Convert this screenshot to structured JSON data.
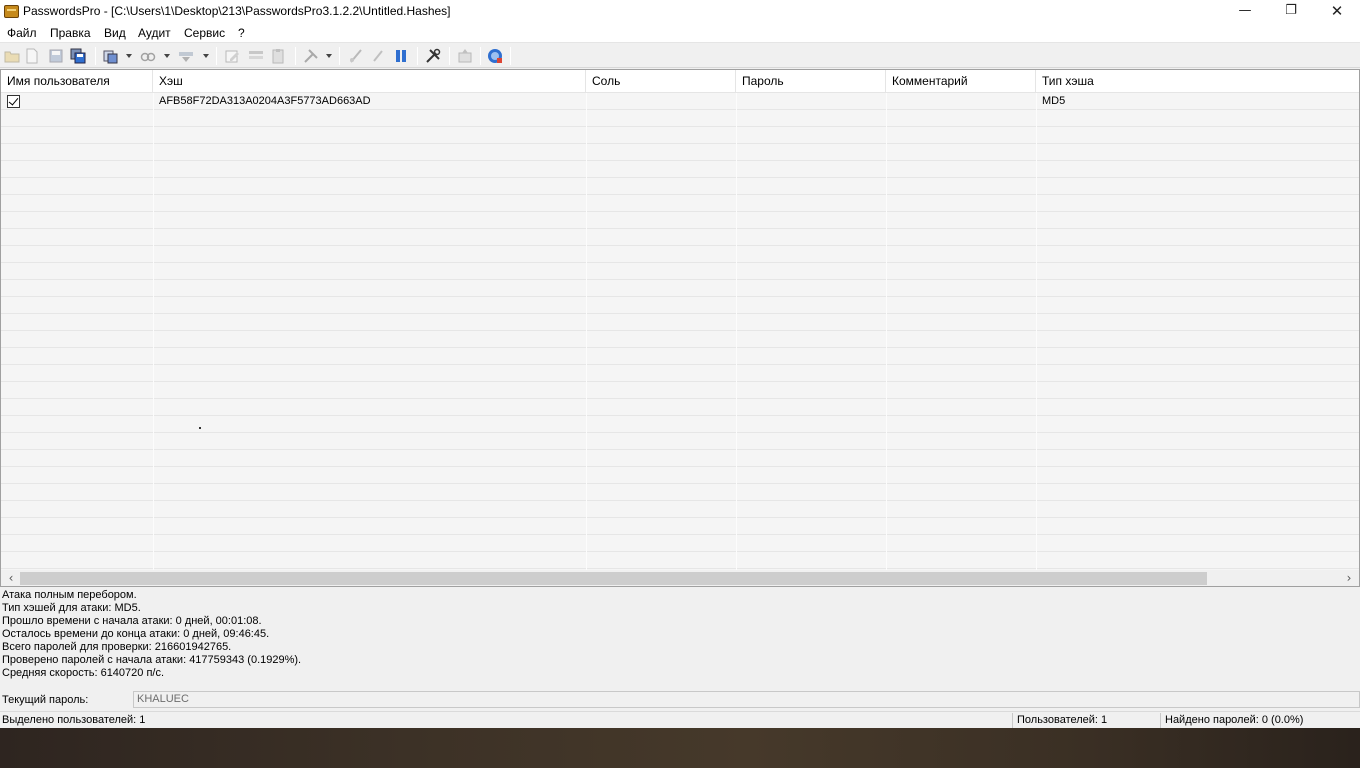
{
  "window": {
    "title": "PasswordsPro - [C:\\Users\\1\\Desktop\\213\\PasswordsPro3.1.2.2\\Untitled.Hashes]",
    "minimize_glyph": "—",
    "maximize_glyph": "❐",
    "close_glyph": "✕"
  },
  "menu": [
    "Файл",
    "Правка",
    "Вид",
    "Аудит",
    "Сервис",
    "?"
  ],
  "grid": {
    "columns": [
      "Имя пользователя",
      "Хэш",
      "Соль",
      "Пароль",
      "Комментарий",
      "Тип хэша"
    ],
    "rows": [
      {
        "checked": true,
        "user": "",
        "hash": "AFB58F72DA313A0204A3F5773AD663AD",
        "salt": "",
        "password": "",
        "comment": "",
        "hash_type": "MD5"
      }
    ]
  },
  "scrollbar": {
    "left_glyph": "‹",
    "right_glyph": "›"
  },
  "log": [
    "Атака полным перебором.",
    "Тип хэшей для атаки: MD5.",
    "Прошло времени с начала атаки: 0 дней, 00:01:08.",
    "Осталось времени до конца атаки: 0 дней, 09:46:45.",
    "Всего паролей для проверки: 216601942765.",
    "Проверено паролей с начала атаки: 417759343 (0.1929%).",
    "Средняя скорость: 6140720 п/с."
  ],
  "current_password": {
    "label": "Текущий пароль:",
    "value": "KHALUEC"
  },
  "status": {
    "selected": "Выделено пользователей: 1",
    "users": "Пользователей: 1",
    "found": "Найдено паролей: 0 (0.0%)"
  },
  "colors": {
    "toolbar_blue": "#2f6fd0",
    "accent_gold": "#c68a1c"
  }
}
